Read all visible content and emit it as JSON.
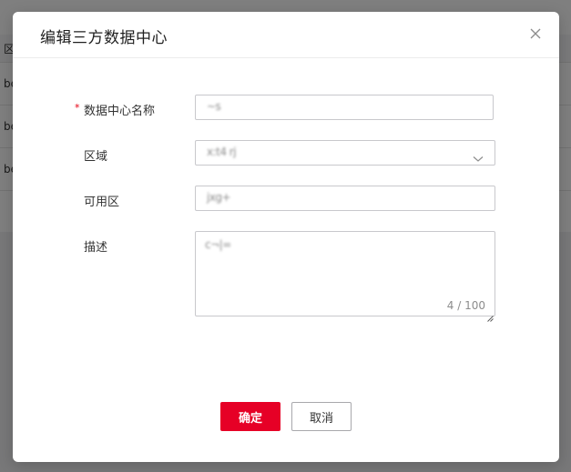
{
  "background": {
    "header_cell": "区",
    "rows": [
      "be",
      "be",
      "be"
    ]
  },
  "dialog": {
    "title": "编辑三方数据中心",
    "close_icon": "close-icon",
    "fields": {
      "name": {
        "label": "数据中心名称",
        "required_mark": "*",
        "value": "~s"
      },
      "region": {
        "label": "区域",
        "value": "x:t4 rj"
      },
      "zone": {
        "label": "可用区",
        "value": "jxg+"
      },
      "description": {
        "label": "描述",
        "value": "c¬|=",
        "char_count": "4 / 100"
      }
    },
    "buttons": {
      "confirm": "确定",
      "cancel": "取消"
    }
  },
  "colors": {
    "primary": "#e60026",
    "required": "#e60012",
    "border": "#c8c8cc"
  }
}
